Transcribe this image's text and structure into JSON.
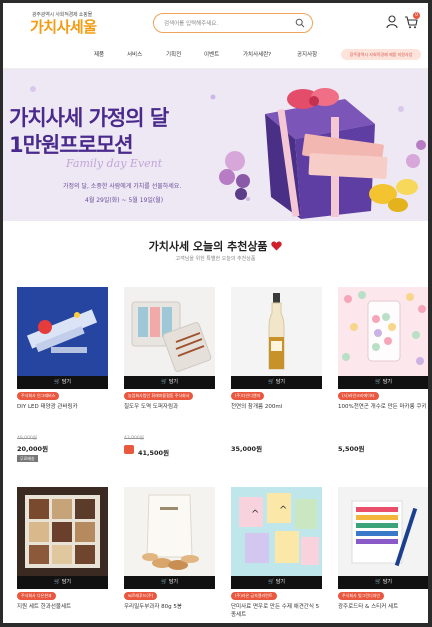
{
  "header": {
    "logo_sub": "광주광역시 사회적경제 쇼핑몰",
    "logo": "가치사세울",
    "search_placeholder": "검색어를 입력해주세요.",
    "cart_count": "0"
  },
  "nav": {
    "items": [
      "제품",
      "서비스",
      "기획전",
      "이벤트",
      "가치사세란?",
      "공지사항"
    ],
    "pill": "광주광역시 사회적경제 제품 지원사업"
  },
  "banner": {
    "line1": "가치사세 가정의 달",
    "line2": "1만원프로모션",
    "script": "Family day Event",
    "sub": "가정의 달, 소중한 사람에게 가치를 선물하세요.",
    "date": "4월 29일(화) ~ 5월 19일(월)"
  },
  "section": {
    "title": "가치사세 오늘의 추천상품",
    "sub": "고객님을 위한 특별한 오늘의 추천상품"
  },
  "cart_label": "담기",
  "products": [
    {
      "badge": "주식회사 인그래비스",
      "name": "DIY LED 태양광 관바링카",
      "orig": "48,000원",
      "price": "20,000원",
      "ship": "무료배송"
    },
    {
      "badge": "농업회사법인 휘래마을협동 주식회사",
      "name": "칠도우 도역 도퍼자림과",
      "orig": "43,000원",
      "price": "41,500원"
    },
    {
      "badge": "(주)다인디앤미",
      "name": "천연의 참개름 200ml",
      "price": "35,000원"
    },
    {
      "badge": "(사)라인크리에이터",
      "name": "100%천연곤 개수로 만든 마카롱 쿠키",
      "price": "5,500원"
    },
    {
      "badge": "주식회사 다은한과",
      "name": "지원 세트 한과선물세트"
    },
    {
      "badge": "씨르레푸드(주)",
      "name": "우리밀두부과자 80g 5봉"
    },
    {
      "badge": "(주)라온 금속엘리먼트",
      "name": "단미사료 면우로 만든 수제 애견간식 5종세트"
    },
    {
      "badge": "주식회사 빛그린디자인",
      "name": "광주로드타 & 스티커 세트"
    }
  ]
}
